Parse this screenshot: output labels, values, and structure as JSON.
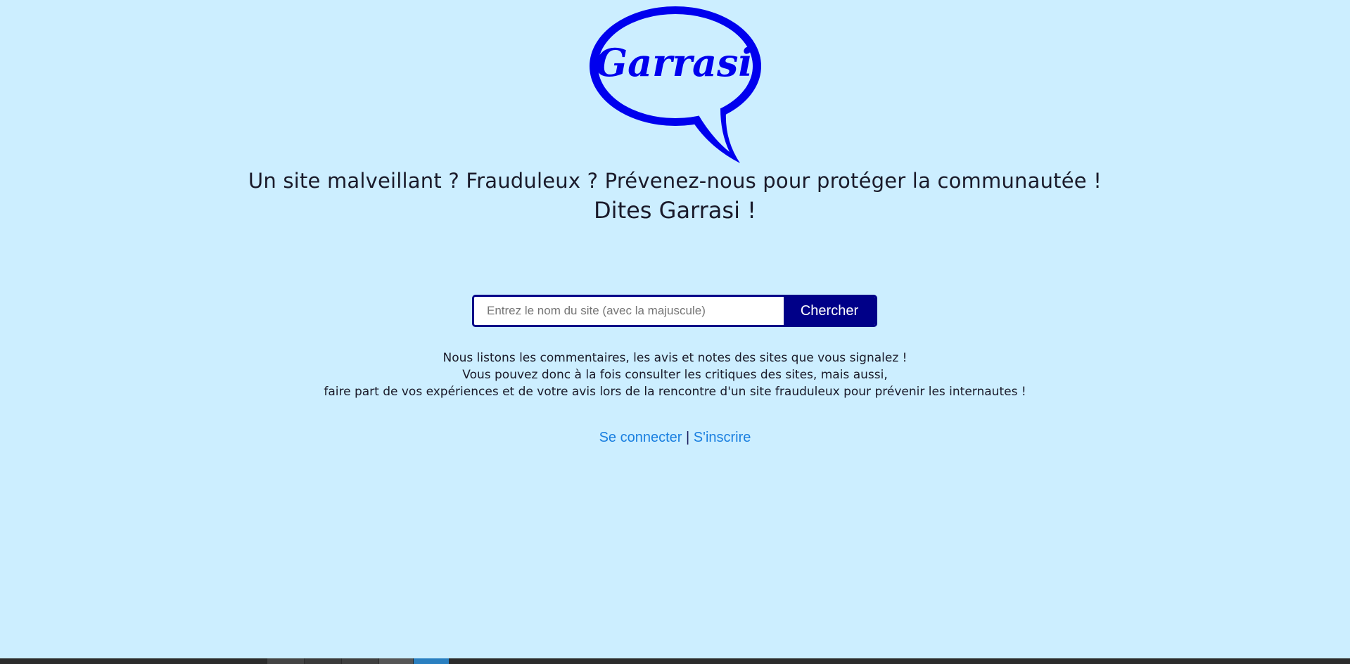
{
  "logo": {
    "text": "Garrasi",
    "color": "#0000ee",
    "icon": "speech-bubble-logo"
  },
  "tagline": "Un site malveillant ? Frauduleux ? Prévenez-nous pour protéger la communautée !",
  "slogan": "Dites Garrasi !",
  "search": {
    "placeholder": "Entrez le nom du site (avec la majuscule)",
    "value": "",
    "button_label": "Chercher"
  },
  "description": {
    "line1": "Nous listons les commentaires, les avis et notes des sites que vous signalez !",
    "line2": "Vous pouvez donc à la fois consulter les critiques des sites, mais aussi,",
    "line3": "faire part de vos expériences et de votre avis lors de la rencontre d'un site frauduleux pour prévenir les internautes !"
  },
  "auth": {
    "login_label": "Se connecter",
    "separator": "|",
    "signup_label": "S'inscrire"
  },
  "colors": {
    "background": "#cceeff",
    "accent": "#000088",
    "link": "#1a7fe0",
    "logo": "#0000ee"
  }
}
